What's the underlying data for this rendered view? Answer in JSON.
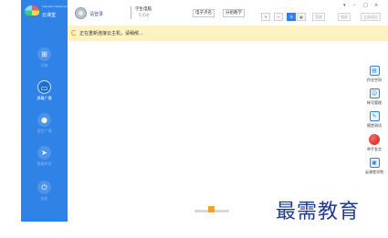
{
  "app": {
    "logo_small_text": "Tianwen Classroom",
    "logo_text": "云课堂"
  },
  "sidebar": {
    "items": [
      {
        "label": "开始",
        "icon": "windows-icon",
        "glyph": "⊞"
      },
      {
        "label": "屏幕广播",
        "icon": "screen-broadcast-icon",
        "glyph": "▭"
      },
      {
        "label": "语音广播",
        "icon": "microphone-icon",
        "glyph": "●"
      },
      {
        "label": "屏幕转发",
        "icon": "send-icon",
        "glyph": "➤"
      },
      {
        "label": "关机",
        "icon": "power-icon",
        "glyph": "⏻"
      }
    ]
  },
  "header": {
    "username": "请登录",
    "user_type": "学生电脑",
    "user_count": "0 /0台",
    "buttons": {
      "roll_call": "电子点名",
      "group_teaching": "分组教学"
    },
    "view_buttons": [
      "+",
      "−",
      "☰",
      "▦"
    ],
    "action_buttons": [
      "黑屏",
      "锁屏",
      "全部退出"
    ],
    "window_controls": [
      "▾",
      "–",
      "□",
      "×"
    ]
  },
  "banner": {
    "text": "正在重新连接云主机，请稍候..."
  },
  "tools": [
    {
      "label": "作业空间",
      "icon": "homework-icon",
      "glyph": "▤"
    },
    {
      "label": "帐号管理",
      "icon": "account-icon",
      "glyph": "☺"
    },
    {
      "label": "随堂测试",
      "icon": "quiz-icon",
      "glyph": "✎"
    },
    {
      "label": "举手发言",
      "icon": "raise-hand-icon",
      "glyph": ""
    },
    {
      "label": "云课堂学院",
      "icon": "academy-icon",
      "glyph": "▣"
    }
  ],
  "watermark": "最需教育",
  "colors": {
    "sidebar": "#2f82e6",
    "banner": "#fdf3c2",
    "watermark": "#1f3a93"
  }
}
